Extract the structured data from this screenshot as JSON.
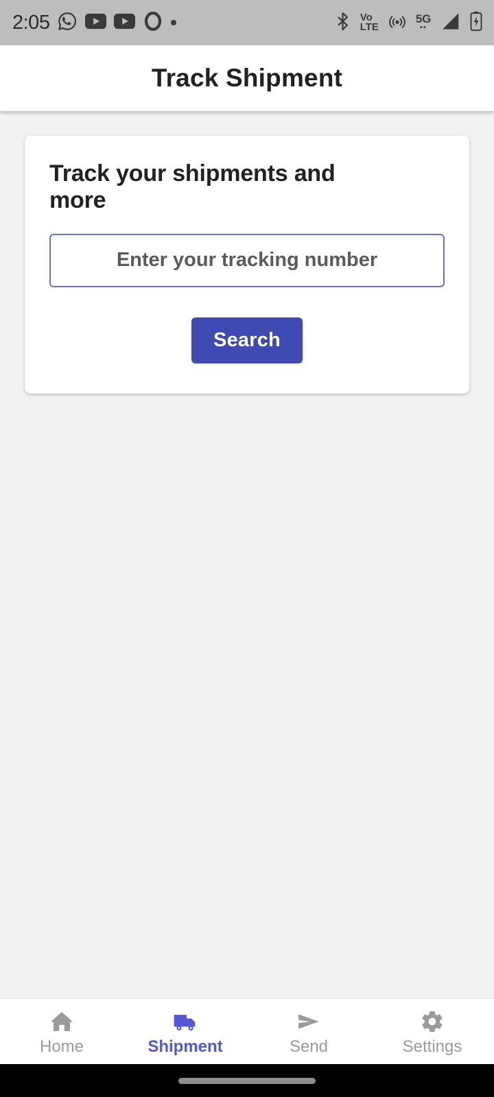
{
  "status_bar": {
    "time": "2:05",
    "left_icons": [
      {
        "name": "whatsapp-icon"
      },
      {
        "name": "youtube-icon"
      },
      {
        "name": "youtube-icon"
      },
      {
        "name": "camera-ring-icon"
      },
      {
        "name": "notification-dot-icon"
      }
    ],
    "right_icons": [
      {
        "name": "bluetooth-icon"
      },
      {
        "name": "volte-icon",
        "line1": "Vo",
        "line2": "LTE"
      },
      {
        "name": "hotspot-icon"
      },
      {
        "name": "network-5g-icon",
        "label": "5G",
        "dots": "▪▪"
      },
      {
        "name": "signal-strength-icon"
      },
      {
        "name": "battery-charging-icon"
      }
    ]
  },
  "app_bar": {
    "title": "Track Shipment"
  },
  "main": {
    "card": {
      "heading": "Track your shipments and more",
      "input": {
        "placeholder": "Enter your tracking number",
        "value": ""
      },
      "search_label": "Search"
    }
  },
  "bottom_nav": {
    "items": [
      {
        "label": "Home",
        "icon": "home-icon",
        "active": false
      },
      {
        "label": "Shipment",
        "icon": "truck-icon",
        "active": true
      },
      {
        "label": "Send",
        "icon": "send-icon",
        "active": false
      },
      {
        "label": "Settings",
        "icon": "gear-icon",
        "active": false
      }
    ]
  },
  "colors": {
    "accent": "#3f4ab3",
    "active_nav": "#5457d4",
    "inactive_nav": "#9a9a9a",
    "background": "#f2f2f2",
    "card": "#ffffff",
    "status_bar": "#bdbdbd",
    "input_border": "#6b72b8",
    "gesture_bar": "#000000"
  }
}
